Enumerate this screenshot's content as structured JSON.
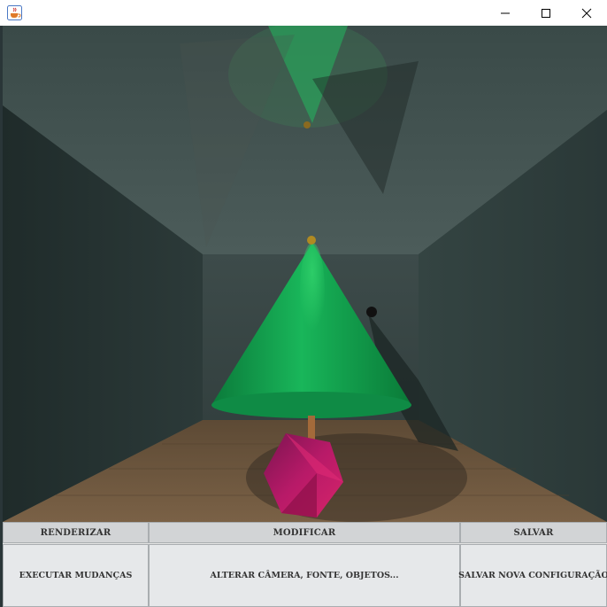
{
  "window": {
    "icon": "java-cup-icon",
    "controls": [
      "minimize-icon",
      "maximize-icon",
      "close-icon"
    ]
  },
  "scene": {
    "description_icon": "rendered-3d-room",
    "colors": {
      "cone": "#0f9a48",
      "floor": "#6b553c",
      "walls": "#2f3d3c",
      "gem": "#b81a68"
    }
  },
  "panel": {
    "renderizar": {
      "header": "RENDERIZAR",
      "action": "EXECUTAR MUDANÇAS"
    },
    "modificar": {
      "header": "MODIFICAR",
      "action": "ALTERAR CÂMERA, FONTE, OBJETOS..."
    },
    "salvar": {
      "header": "SALVAR",
      "action": "SALVAR NOVA CONFIGURAÇÃO"
    }
  }
}
